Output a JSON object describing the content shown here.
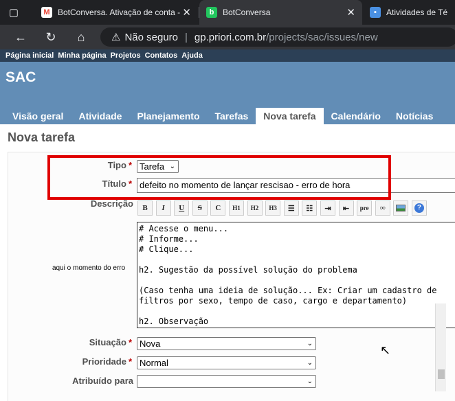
{
  "browser": {
    "tabs": [
      {
        "title": "BotConversa. Ativação de conta -",
        "favicon": "gmail-icon",
        "active": false
      },
      {
        "title": "BotConversa",
        "favicon": "botconversa-icon",
        "active": true
      },
      {
        "title": "Atividades de Té",
        "favicon": "app-icon",
        "active": false
      }
    ],
    "address": {
      "security_text": "Não seguro",
      "host": "gp.priori.com.br",
      "path": "/projects/sac/issues/new"
    }
  },
  "topmenu": {
    "items": [
      "Página inicial",
      "Minha página",
      "Projetos",
      "Contatos",
      "Ajuda"
    ]
  },
  "project": {
    "title": "SAC"
  },
  "mainmenu": {
    "items": [
      "Visão geral",
      "Atividade",
      "Planejamento",
      "Tarefas",
      "Nova tarefa",
      "Calendário",
      "Notícias"
    ],
    "selected": "Nova tarefa"
  },
  "form": {
    "page_title": "Nova tarefa",
    "tipo_label": "Tipo",
    "tipo_value": "Tarefa",
    "titulo_label": "Título",
    "titulo_value": "defeito no momento de lançar rescisao - erro de hora",
    "descricao_label": "Descrição",
    "side_note": "aqui o momento do erro",
    "description_text": "# Acesse o menu...\n# Informe...\n# Clique...\n\nh2. Sugestão da possível solução do problema\n\n(Caso tenha uma ideia de solução... Ex: Criar um cadastro de\nfiltros por sexo, tempo de caso, cargo e departamento)\n\nh2. Observação",
    "situacao_label": "Situação",
    "situacao_value": "Nova",
    "prioridade_label": "Prioridade",
    "prioridade_value": "Normal",
    "atribuido_label": "Atribuído para",
    "atribuido_value": "",
    "required_mark": "*"
  },
  "toolbar": {
    "buttons": [
      {
        "label": "B",
        "name": "bold-button"
      },
      {
        "label": "I",
        "name": "italic-button"
      },
      {
        "label": "U",
        "name": "underline-button"
      },
      {
        "label": "S",
        "name": "strikethrough-button"
      },
      {
        "label": "C",
        "name": "code-button"
      },
      {
        "label": "H1",
        "name": "heading1-button"
      },
      {
        "label": "H2",
        "name": "heading2-button"
      },
      {
        "label": "H3",
        "name": "heading3-button"
      },
      {
        "label": "",
        "name": "unordered-list-button",
        "icon": "bullet-list-icon"
      },
      {
        "label": "",
        "name": "ordered-list-button",
        "icon": "numbered-list-icon"
      },
      {
        "label": "",
        "name": "indent-button",
        "icon": "indent-icon"
      },
      {
        "label": "",
        "name": "outdent-button",
        "icon": "outdent-icon"
      },
      {
        "label": "pre",
        "name": "pre-button"
      },
      {
        "label": "",
        "name": "link-button",
        "icon": "link-icon"
      },
      {
        "label": "",
        "name": "image-button",
        "icon": "image-icon"
      },
      {
        "label": "",
        "name": "help-button",
        "icon": "help-icon"
      }
    ]
  },
  "colors": {
    "header": "#628db6",
    "topmenu": "#2c4056",
    "highlight": "#e00000",
    "required": "#bb0000"
  }
}
